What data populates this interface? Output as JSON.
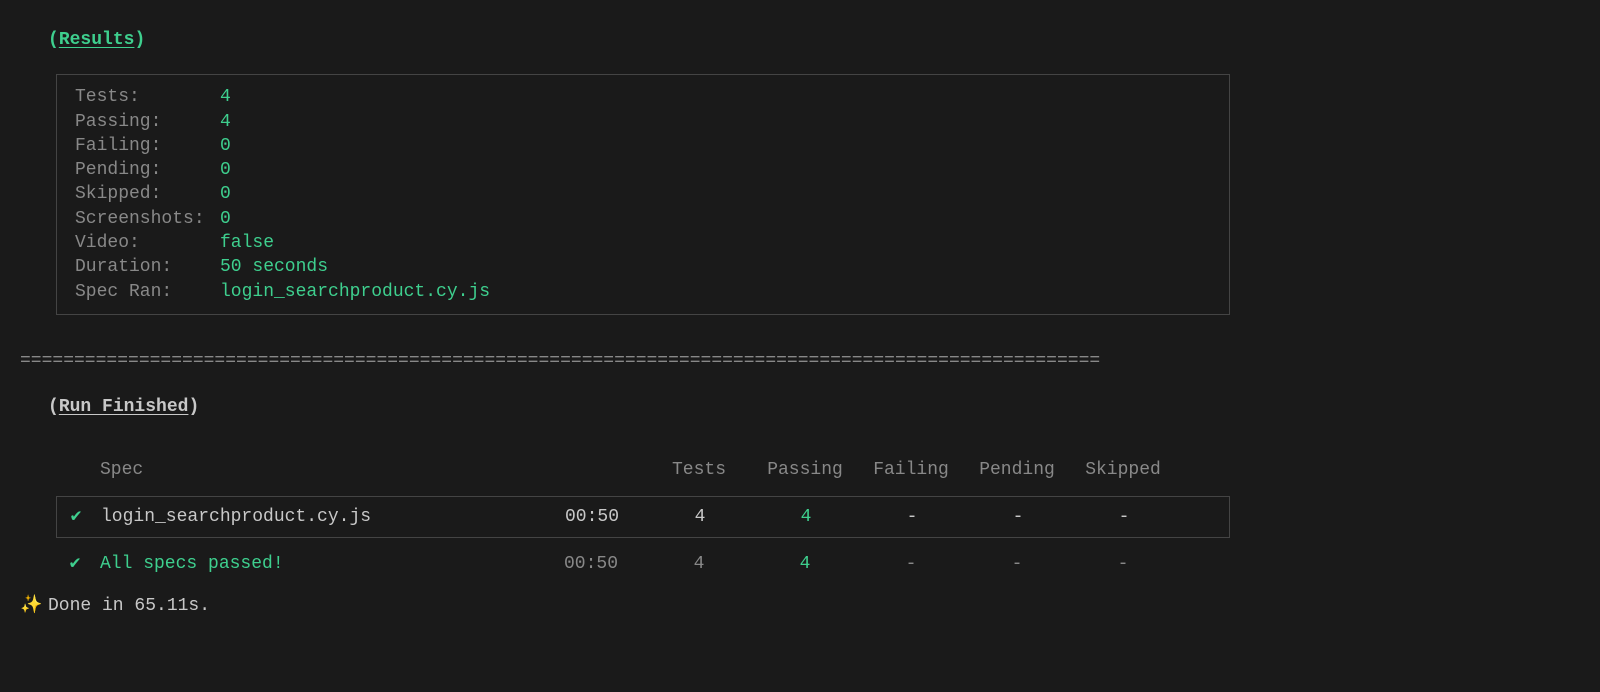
{
  "resultsHeader": {
    "openParen": "(",
    "title": "Results",
    "closeParen": ")"
  },
  "stats": [
    {
      "label": "Tests:",
      "value": "4"
    },
    {
      "label": "Passing:",
      "value": "4"
    },
    {
      "label": "Failing:",
      "value": "0"
    },
    {
      "label": "Pending:",
      "value": "0"
    },
    {
      "label": "Skipped:",
      "value": "0"
    },
    {
      "label": "Screenshots:",
      "value": "0"
    },
    {
      "label": "Video:",
      "value": "false"
    },
    {
      "label": "Duration:",
      "value": "50 seconds"
    },
    {
      "label": "Spec Ran:",
      "value": "login_searchproduct.cy.js"
    }
  ],
  "divider": "====================================================================================================",
  "runFinishedHeader": {
    "openParen": "(",
    "title": "Run Finished",
    "closeParen": ")"
  },
  "tableHeaders": {
    "spec": "Spec",
    "tests": "Tests",
    "passing": "Passing",
    "failing": "Failing",
    "pending": "Pending",
    "skipped": "Skipped"
  },
  "specRow": {
    "check": "✔",
    "name": "login_searchproduct.cy.js",
    "time": "00:50",
    "tests": "4",
    "passing": "4",
    "failing": "-",
    "pending": "-",
    "skipped": "-"
  },
  "totalRow": {
    "check": "✔",
    "label": "All specs passed!",
    "time": "00:50",
    "tests": "4",
    "passing": "4",
    "failing": "-",
    "pending": "-",
    "skipped": "-"
  },
  "doneLine": {
    "sparkle": "✨",
    "text": "Done in 65.11s."
  }
}
